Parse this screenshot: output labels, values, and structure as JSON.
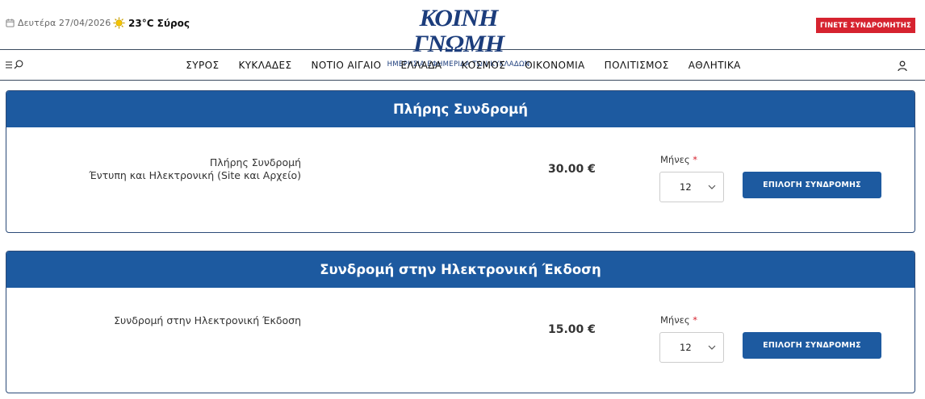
{
  "header": {
    "date": "Δευτέρα 27/04/2026",
    "weather": "23°C Σύρος",
    "logo": "ΚΟΙΝΗ ΓΝΩΜΗ",
    "tagline": "ΗΜΕΡΗΣΙΑ ΕΦΗΜΕΡΙΔΑ ΤΩΝ ΚΥΚΛΑΔΩΝ",
    "subscribe_label": "ΓΙΝΕΤΕ ΣΥΝΔΡΟΜΗΤΗΣ"
  },
  "nav": {
    "items": [
      {
        "label": "ΣΥΡΟΣ"
      },
      {
        "label": "ΚΥΚΛΑΔΕΣ"
      },
      {
        "label": "ΝΟΤΙΟ ΑΙΓΑΙΟ"
      },
      {
        "label": "ΕΛΛΑΔΑ"
      },
      {
        "label": "ΚΟΣΜΟΣ"
      },
      {
        "label": "ΟΙΚΟΝΟΜΙΑ"
      },
      {
        "label": "ΠΟΛΙΤΙΣΜΟΣ"
      },
      {
        "label": "ΑΘΛΗΤΙΚΑ"
      }
    ]
  },
  "plans": [
    {
      "title": "Πλήρης Συνδρομή",
      "desc_line1": "Πλήρης Συνδρομή",
      "desc_line2": "Έντυπη και Ηλεκτρονική (Site και Αρχείο)",
      "price": "30.00 €",
      "months_label": "Μήνες",
      "required_mark": "*",
      "months_value": "12",
      "button_label": "ΕΠΙΛΟΓΗ ΣΥΝΔΡΟΜΗΣ"
    },
    {
      "title": "Συνδρομή στην Ηλεκτρονική Έκδοση",
      "desc_line1": "Συνδρομή στην Ηλεκτρονική Έκδοση",
      "desc_line2": "",
      "price": "15.00 €",
      "months_label": "Μήνες",
      "required_mark": "*",
      "months_value": "12",
      "button_label": "ΕΠΙΛΟΓΗ ΣΥΝΔΡΟΜΗΣ"
    }
  ],
  "icons": {
    "calendar": "calendar-icon",
    "weather": "sun-icon",
    "menu": "menu-icon",
    "search": "search-icon",
    "user": "user-icon",
    "dropdown": "chevron-down-icon"
  },
  "colors": {
    "brand_blue": "#1d5aa0",
    "logo_blue": "#1c3d7c",
    "subscribe_red": "#d6232f"
  }
}
